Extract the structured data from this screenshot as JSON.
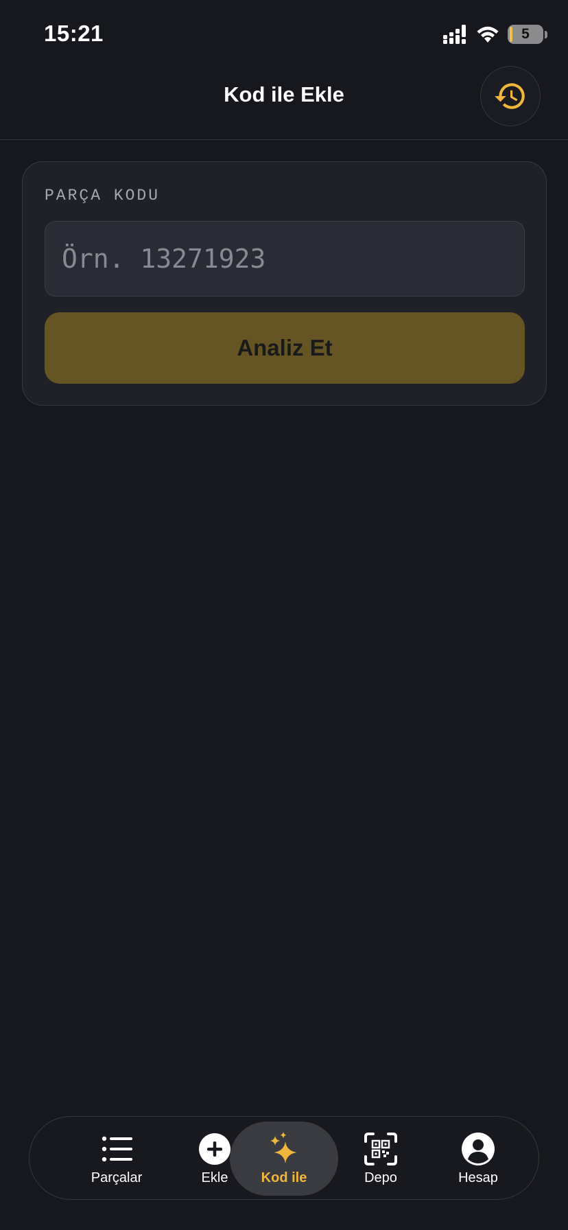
{
  "status_bar": {
    "time": "15:21",
    "battery_level": "5",
    "icons": [
      "signal-icon",
      "wifi-icon",
      "battery-icon"
    ]
  },
  "header": {
    "title": "Kod ile Ekle",
    "history_icon": "history-icon"
  },
  "form": {
    "label": "PARÇA KODU",
    "input_value": "",
    "input_placeholder": "Örn. 13271923",
    "submit_label": "Analiz Et"
  },
  "tab_bar": {
    "active_index": 2,
    "items": [
      {
        "label": "Parçalar",
        "icon": "list-icon"
      },
      {
        "label": "Ekle",
        "icon": "plus-circle-icon"
      },
      {
        "label": "Kod ile",
        "icon": "sparkles-icon"
      },
      {
        "label": "Depo",
        "icon": "qr-scan-icon"
      },
      {
        "label": "Hesap",
        "icon": "account-icon"
      }
    ]
  },
  "colors": {
    "background": "#17181d",
    "accent": "#f0b73c",
    "button_bg": "#655424"
  }
}
